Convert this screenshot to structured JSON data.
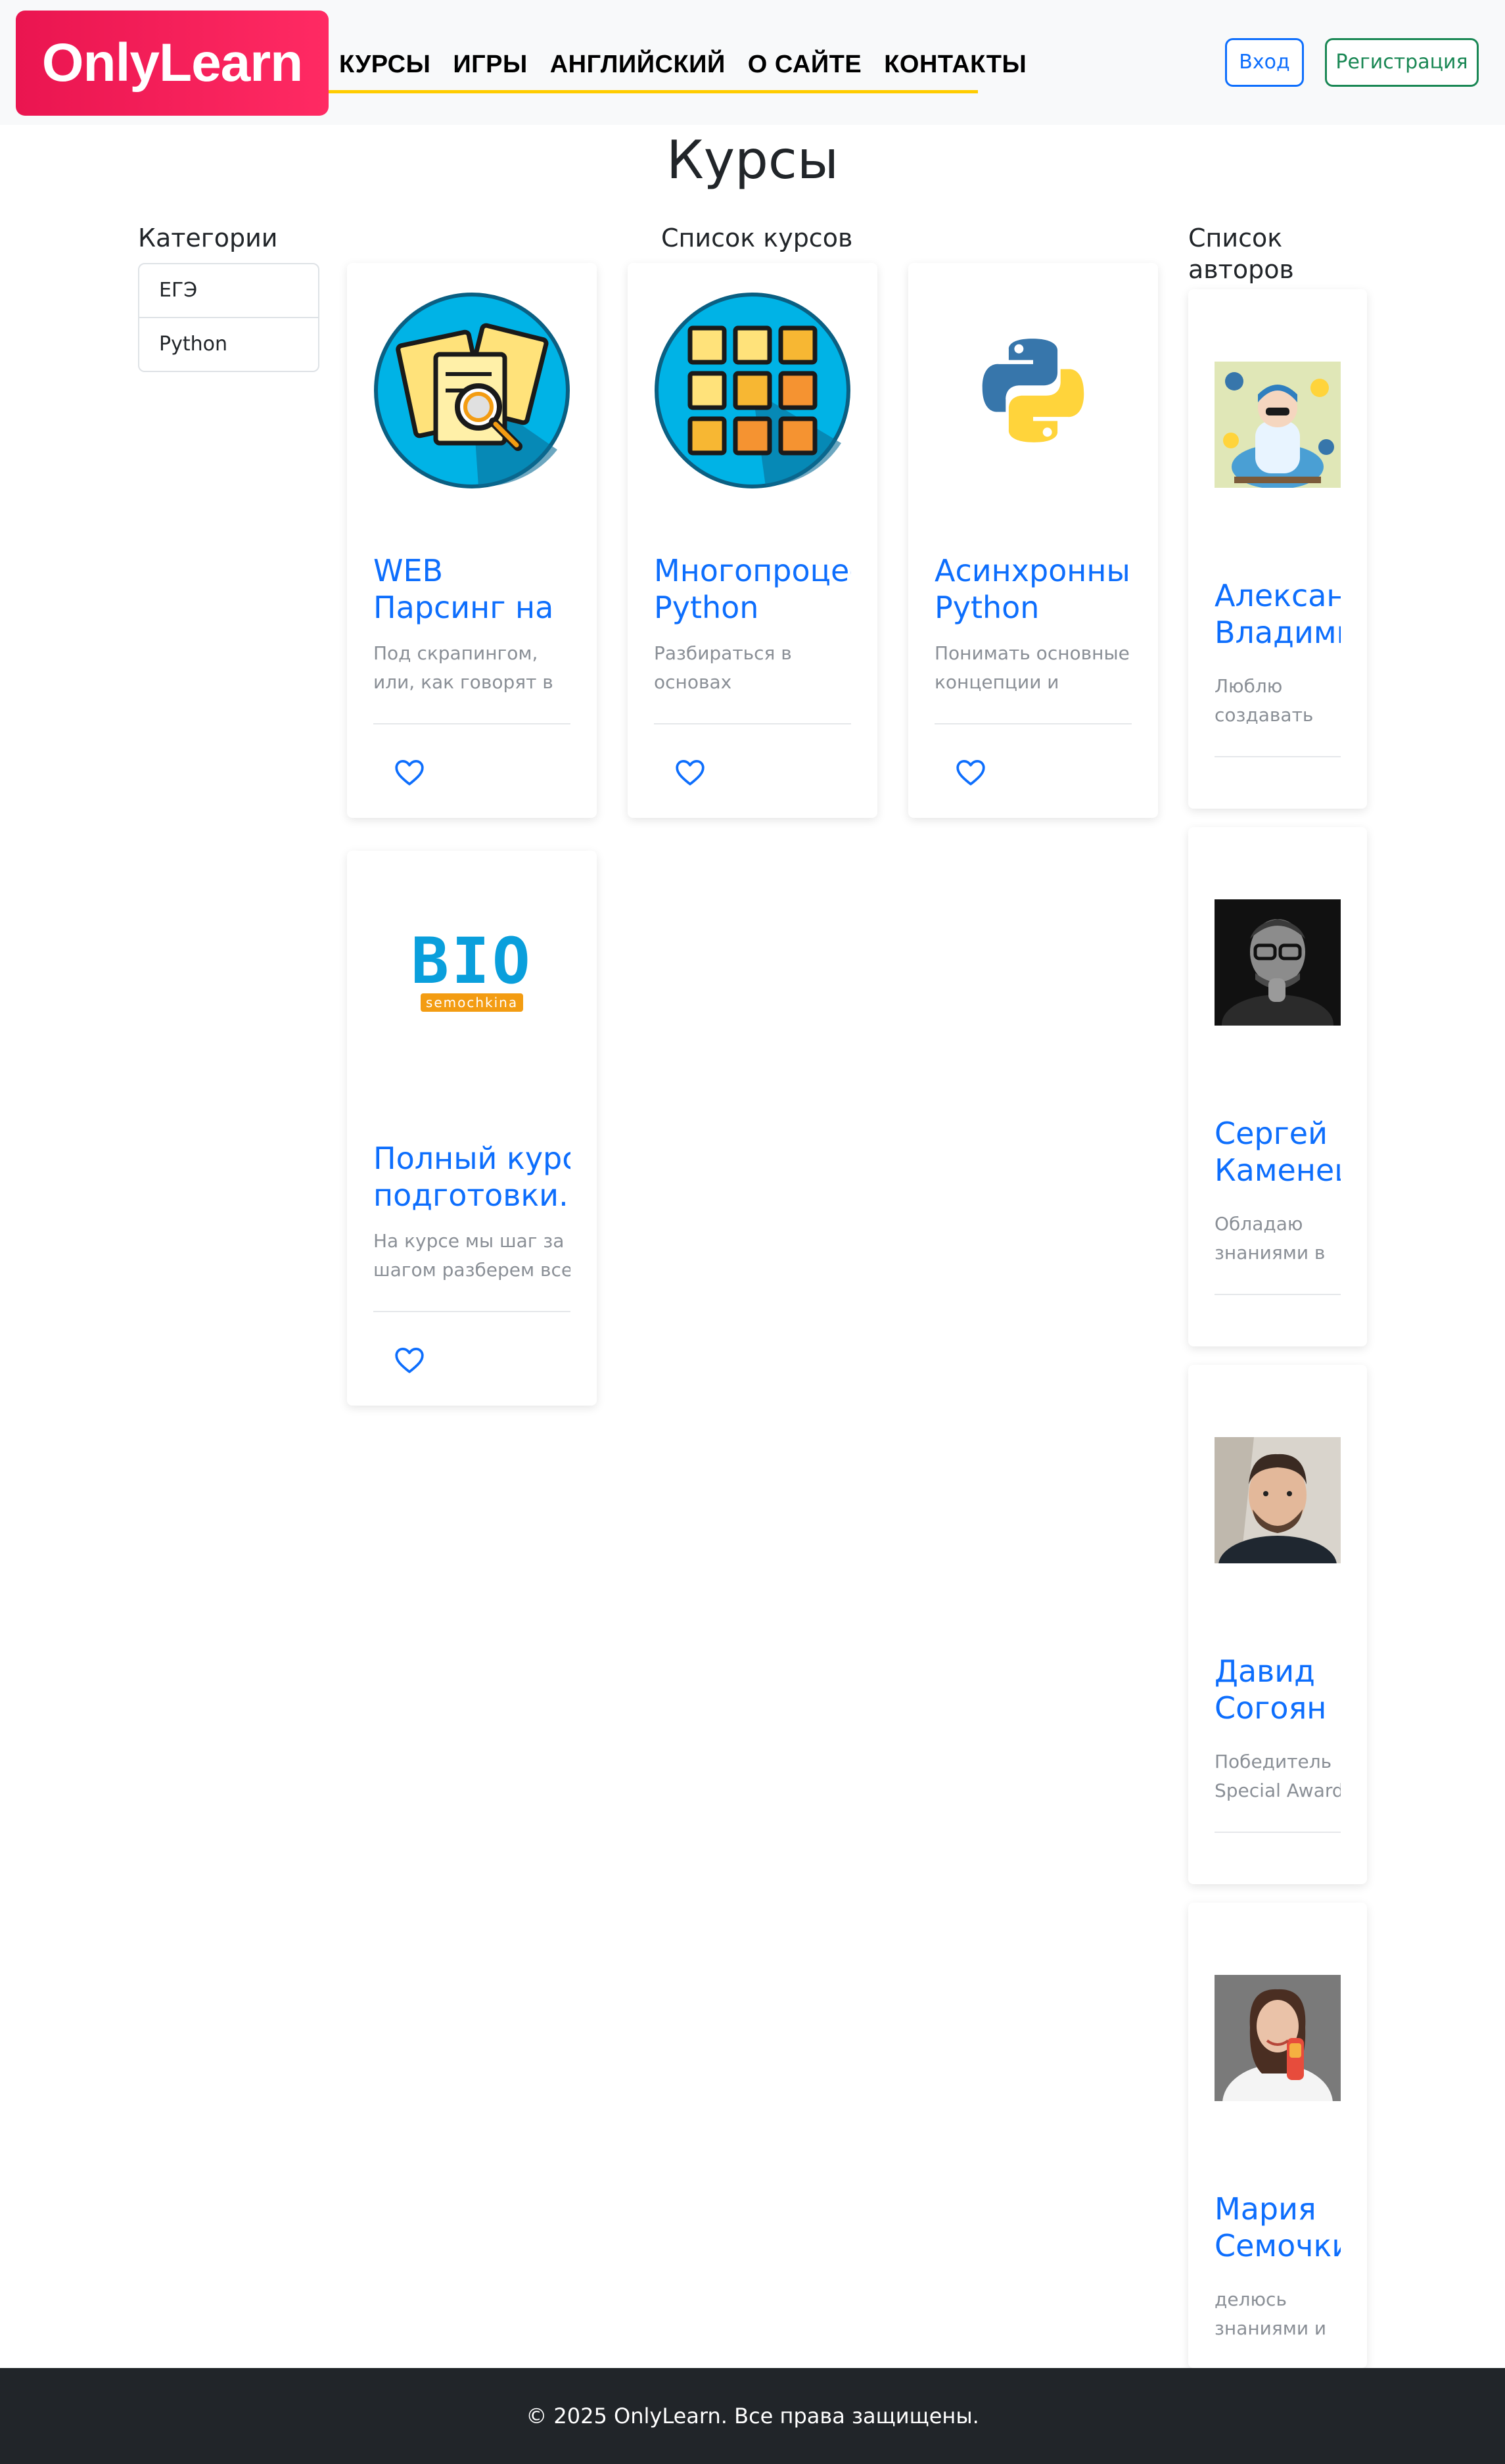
{
  "brand": {
    "logo_text": "OnlyLearn"
  },
  "nav": {
    "items": [
      {
        "label": "КУРСЫ"
      },
      {
        "label": "ИГРЫ"
      },
      {
        "label": "АНГЛИЙСКИЙ"
      },
      {
        "label": "О САЙТЕ"
      },
      {
        "label": "КОНТАКТЫ"
      }
    ],
    "login_label": "Вход",
    "register_label": "Регистрация"
  },
  "page": {
    "title": "Курсы"
  },
  "categories": {
    "title": "Категории",
    "items": [
      {
        "label": "ЕГЭ"
      },
      {
        "label": "Python"
      }
    ]
  },
  "courses": {
    "title": "Список курсов",
    "items": [
      {
        "title_line1": "WEB",
        "title_line2": "Парсинг на",
        "desc_line1": "Под скрапингом,",
        "desc_line2": "или, как говорят в",
        "icon": "documents-magnifier-icon"
      },
      {
        "title_line1": "Многопроцес",
        "title_line2": "Python",
        "desc_line1": "Разбираться в",
        "desc_line2": "основах",
        "icon": "grid-squares-icon"
      },
      {
        "title_line1": "Асинхронный",
        "title_line2": "Python",
        "desc_line1": "Понимать основные",
        "desc_line2": "концепции и",
        "icon": "python-logo-icon"
      },
      {
        "title_line1": "Полный курс",
        "title_line2": "подготовки.",
        "desc_line1": "На курсе мы шаг за",
        "desc_line2": "шагом разберем все",
        "icon": "bio-logo-icon"
      }
    ],
    "bio_logo_text": "BIO",
    "bio_logo_subtext": "semochkina"
  },
  "authors": {
    "title_line1": "Список",
    "title_line2": "авторов",
    "items": [
      {
        "name_line1": "Александр",
        "name_line2": "Владимир",
        "bio_line1": "Люблю",
        "bio_line2": "создавать"
      },
      {
        "name_line1": "Сергей",
        "name_line2": "Каменецкий",
        "bio_line1": "Обладаю",
        "bio_line2": "знаниями в"
      },
      {
        "name_line1": "Давид",
        "name_line2": "Согоян",
        "bio_line1": "Победитель",
        "bio_line2": "Special Award"
      },
      {
        "name_line1": "Мария",
        "name_line2": "Семочкина",
        "bio_line1": "делюсь",
        "bio_line2": "знаниями и"
      }
    ]
  },
  "footer": {
    "text": "© 2025 OnlyLearn. Все права защищены."
  },
  "colors": {
    "accent": "#0d6efd",
    "brand": "#ff1a5a",
    "success": "#198754",
    "underline": "#ffcc00",
    "footer_bg": "#212529"
  }
}
